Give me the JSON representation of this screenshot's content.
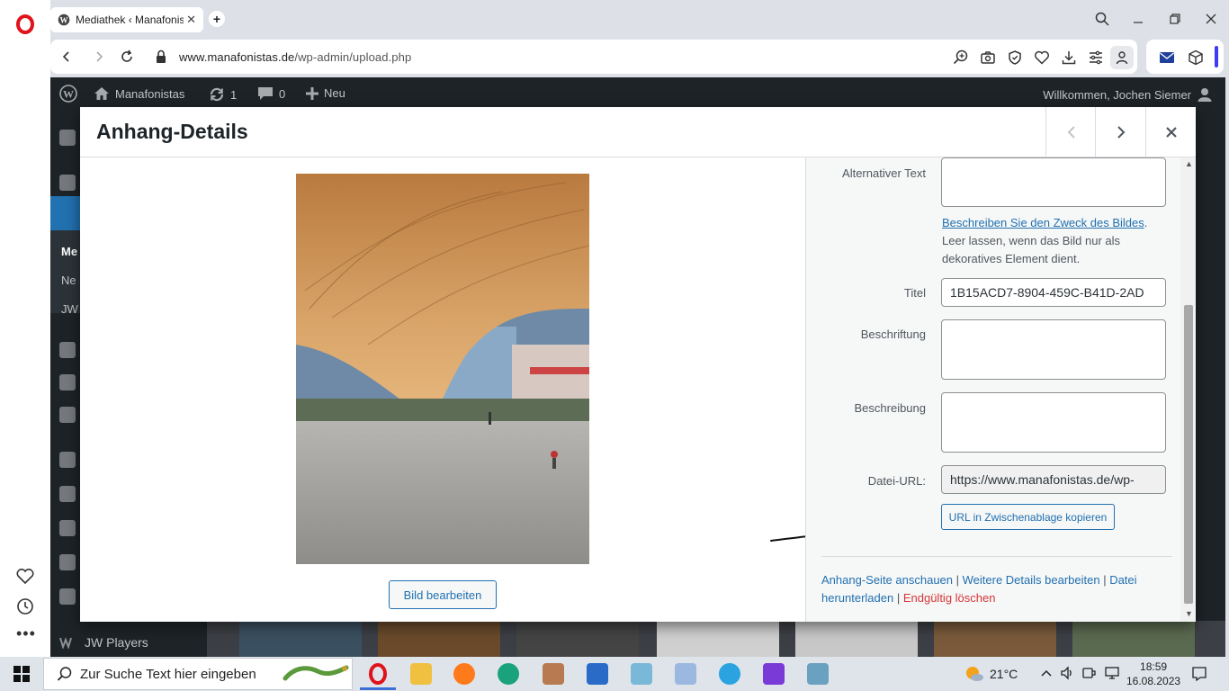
{
  "browser": {
    "tab_title": "Mediathek ‹ Manafonistas",
    "url_host": "www.manafonistas.de",
    "url_path": "/wp-admin/upload.php"
  },
  "wp_admin_bar": {
    "site_name": "Manafonistas",
    "updates_count": "1",
    "comments_count": "0",
    "new_label": "Neu",
    "greeting": "Willkommen, Jochen Siemer"
  },
  "wp_sidebar": {
    "items": [
      "Me",
      "Ne",
      "JW"
    ],
    "bottom_label": "JW Players"
  },
  "modal": {
    "title": "Anhang-Details",
    "edit_image_button": "Bild bearbeiten",
    "fields": {
      "alt_label": "Alternativer Text",
      "alt_help_link": "Beschreiben Sie den Zweck des Bildes",
      "alt_help_text": "Leer lassen, wenn das Bild nur als dekoratives Element dient.",
      "title_label": "Titel",
      "title_value": "1B15ACD7-8904-459C-B41D-2AD",
      "caption_label": "Beschriftung",
      "description_label": "Beschreibung",
      "file_url_label": "Datei-URL:",
      "file_url_value": "https://www.manafonistas.de/wp-",
      "copy_url_button": "URL in Zwischenablage kopieren"
    },
    "actions": {
      "view_page": "Anhang-Seite anschauen",
      "edit_more": "Weitere Details bearbeiten",
      "download": "Datei herunterladen",
      "delete": "Endgültig löschen"
    }
  },
  "taskbar": {
    "search_placeholder": "Zur Suche Text hier eingeben",
    "weather": "21°C",
    "time": "18:59",
    "date": "16.08.2023"
  },
  "colors": {
    "wp_dark": "#1d2327",
    "wp_link": "#2271b1",
    "wp_delete": "#d63638",
    "opera_red": "#e0131c",
    "browser_chrome": "#dde1e7"
  }
}
